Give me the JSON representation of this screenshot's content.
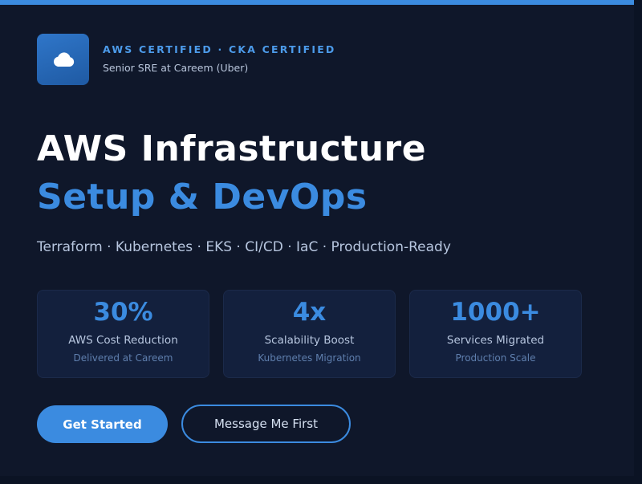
{
  "header": {
    "logo_icon": "cloud-icon",
    "certifications": "AWS CERTIFIED · CKA CERTIFIED",
    "role": "Senior SRE at Careem (Uber)"
  },
  "hero": {
    "title_line_1": "AWS Infrastructure",
    "title_line_2": "Setup & DevOps",
    "subtitle": "Terraform · Kubernetes · EKS · CI/CD · IaC · Production-Ready"
  },
  "stats": [
    {
      "value": "30%",
      "label": "AWS Cost Reduction",
      "sub": "Delivered at Careem"
    },
    {
      "value": "4x",
      "label": "Scalability Boost",
      "sub": "Kubernetes Migration"
    },
    {
      "value": "1000+",
      "label": "Services Migrated",
      "sub": "Production Scale"
    }
  ],
  "actions": {
    "primary_label": "Get Started",
    "secondary_label": "Message Me First"
  },
  "colors": {
    "accent": "#3b8be0",
    "background": "#0f172a",
    "card": "#13203d"
  }
}
